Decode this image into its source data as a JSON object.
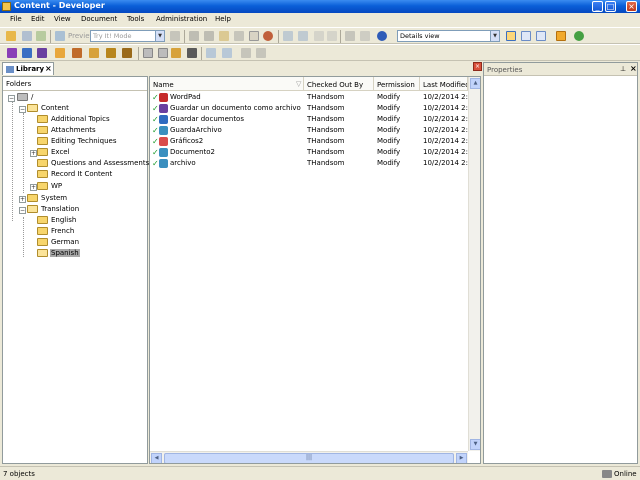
{
  "window": {
    "title": "Content - Developer"
  },
  "menu": [
    "File",
    "Edit",
    "View",
    "Document",
    "Tools",
    "Administration",
    "Help"
  ],
  "toolbar": {
    "preview_label": "Preview",
    "mode_select": "Try It! Mode",
    "view_select": "Details view"
  },
  "library_tab": {
    "label": "Library"
  },
  "folders_panel": {
    "header": "Folders",
    "tree": [
      {
        "label": "/",
        "depth": 0,
        "expanded": true
      },
      {
        "label": "Content",
        "depth": 1,
        "expanded": true
      },
      {
        "label": "Additional Topics",
        "depth": 2
      },
      {
        "label": "Attachments",
        "depth": 2
      },
      {
        "label": "Editing Techniques",
        "depth": 2
      },
      {
        "label": "Excel",
        "depth": 2,
        "expandable": true
      },
      {
        "label": "Questions and Assessments",
        "depth": 2
      },
      {
        "label": "Record It Content",
        "depth": 2
      },
      {
        "label": "WP",
        "depth": 2,
        "expandable": true
      },
      {
        "label": "System",
        "depth": 1,
        "expandable": true
      },
      {
        "label": "Translation",
        "depth": 1,
        "expanded": true
      },
      {
        "label": "English",
        "depth": 2
      },
      {
        "label": "French",
        "depth": 2
      },
      {
        "label": "German",
        "depth": 2
      },
      {
        "label": "Spanish",
        "depth": 2,
        "selected": true
      }
    ]
  },
  "file_list": {
    "columns": [
      "Name",
      "Checked Out By",
      "Permission",
      "Last Modified D"
    ],
    "rows": [
      {
        "name": "WordPad",
        "checked_out_by": "THandsom",
        "permission": "Modify",
        "modified": "10/2/2014 2:4",
        "icon": "wordpad-icon",
        "color": "#c62b2b"
      },
      {
        "name": "Guardar un documento como archivo nuevo",
        "checked_out_by": "THandsom",
        "permission": "Modify",
        "modified": "10/2/2014 2:3",
        "icon": "topic-icon",
        "color": "#6a3fa0"
      },
      {
        "name": "Guardar documentos",
        "checked_out_by": "THandsom",
        "permission": "Modify",
        "modified": "10/2/2014 2:3",
        "icon": "module-icon",
        "color": "#2f6bc0"
      },
      {
        "name": "GuardaArchivo",
        "checked_out_by": "THandsom",
        "permission": "Modify",
        "modified": "10/2/2014 2:3",
        "icon": "package-icon",
        "color": "#3a8fbf"
      },
      {
        "name": "Gráficos2",
        "checked_out_by": "THandsom",
        "permission": "Modify",
        "modified": "10/2/2014 2:3",
        "icon": "graphic-icon",
        "color": "#d94c4c"
      },
      {
        "name": "Documento2",
        "checked_out_by": "THandsom",
        "permission": "Modify",
        "modified": "10/2/2014 2:3",
        "icon": "package-icon",
        "color": "#3a8fbf"
      },
      {
        "name": "archivo",
        "checked_out_by": "THandsom",
        "permission": "Modify",
        "modified": "10/2/2014 2:3",
        "icon": "package-icon",
        "color": "#3a8fbf"
      }
    ],
    "scroll_thumb": "|||"
  },
  "properties_panel": {
    "header": "Properties",
    "pin": "⊥",
    "close": "×"
  },
  "status": {
    "count": "7 objects",
    "connection": "Online"
  }
}
